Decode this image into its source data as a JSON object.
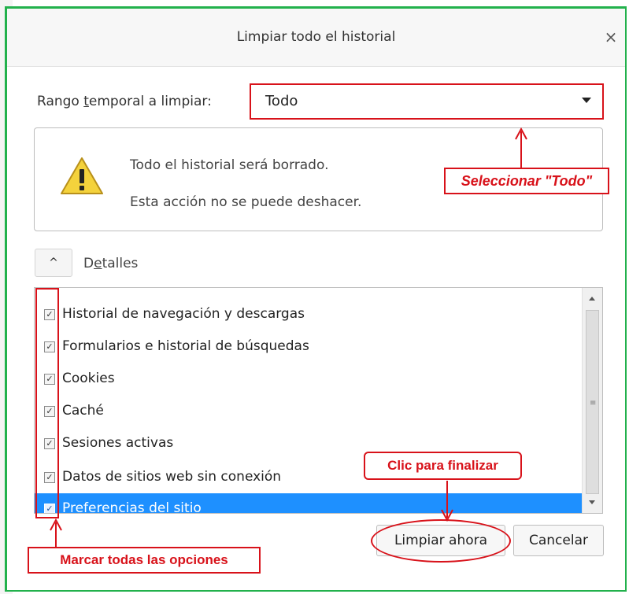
{
  "dialog": {
    "title": "Limpiar todo el historial",
    "close_icon": "close-icon",
    "range_label_pre": "Rango ",
    "range_label_u": "t",
    "range_label_post": "emporal a limpiar:",
    "range_value": "Todo",
    "warning_icon": "warning-icon",
    "warning_line1": "Todo el historial será borrado.",
    "warning_line2": "Esta acción no se puede deshacer.",
    "details_toggle": "^",
    "details_label_pre": "D",
    "details_label_u": "e",
    "details_label_post": "talles",
    "items": [
      {
        "label": "Historial de navegación y descargas",
        "checked": true
      },
      {
        "label": "Formularios e historial de búsquedas",
        "checked": true
      },
      {
        "label": "Cookies",
        "checked": true
      },
      {
        "label": "Caché",
        "checked": true
      },
      {
        "label": "Sesiones activas",
        "checked": true
      },
      {
        "label": "Datos de sitios web sin conexión",
        "checked": true
      },
      {
        "label": "Preferencias del sitio",
        "checked": true,
        "selected": true
      }
    ],
    "check_mark": "✓",
    "clear_button": "Limpiar ahora",
    "cancel_button": "Cancelar"
  },
  "annotations": {
    "select_todo": "Seleccionar \"Todo\"",
    "mark_all": "Marcar todas las opciones",
    "click_finish": "Clic para finalizar"
  },
  "colors": {
    "annotation": "#d8121a",
    "window_border": "#22b14c",
    "selection": "#1e90ff"
  }
}
